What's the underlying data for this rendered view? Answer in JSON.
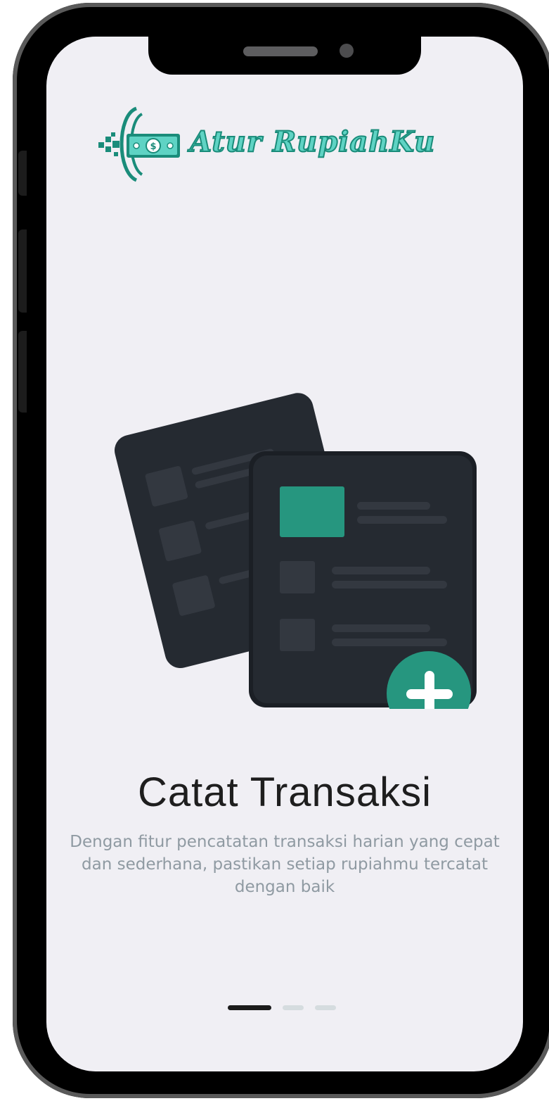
{
  "app": {
    "logo_text": "Atur RupiahKu"
  },
  "onboarding": {
    "title": "Catat Transaksi",
    "description": "Dengan fitur pencatatan transaksi harian yang cepat dan sederhana, pastikan setiap rupiahmu tercatat dengan baik",
    "current_page": 1,
    "total_pages": 3,
    "illustration_icon": "documents-add-icon"
  },
  "colors": {
    "accent": "#26967f",
    "logo": "#5fd3c4",
    "dark": "#252a31",
    "background": "#f0eff4",
    "text_muted": "#8f9aa2",
    "dot_active": "#1b1b1b",
    "dot_inactive": "#d5dcdf"
  }
}
